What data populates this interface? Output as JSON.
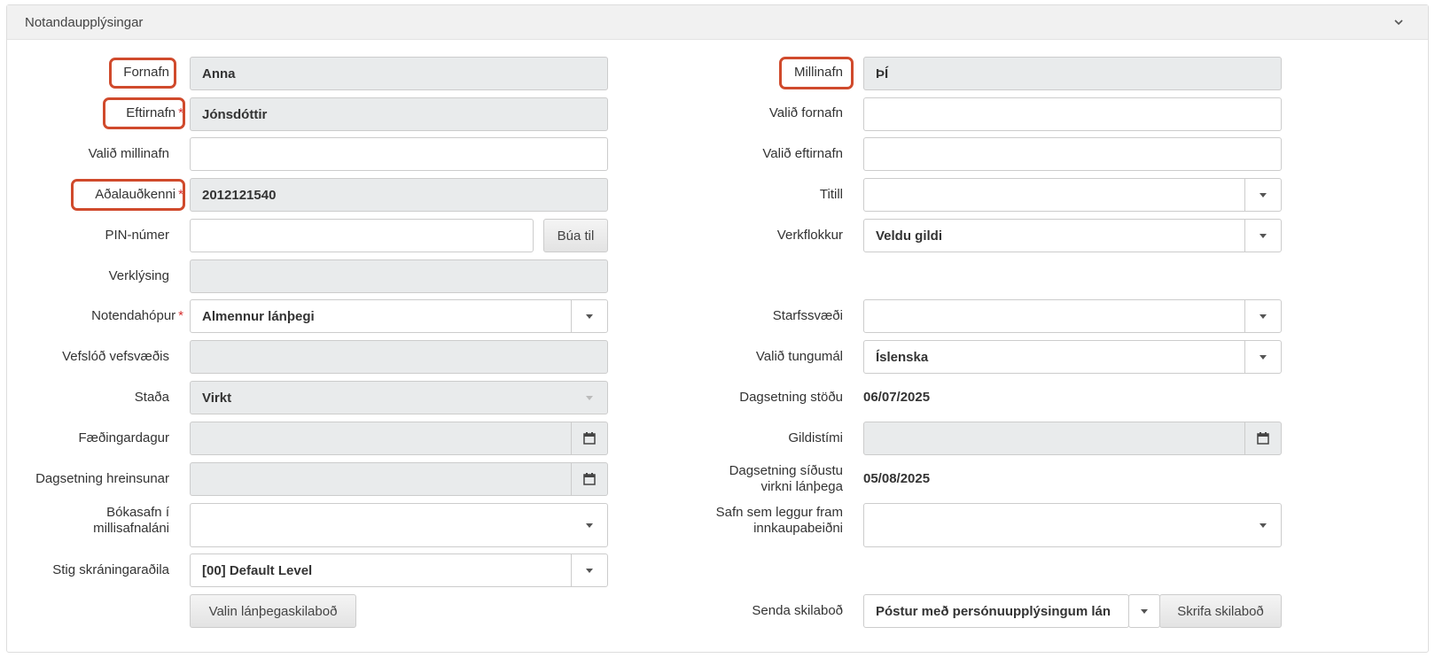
{
  "panel": {
    "title": "Notandaupplýsingar"
  },
  "left": {
    "fornafn": {
      "label": "Fornafn",
      "value": "Anna"
    },
    "eftirnafn": {
      "label": "Eftirnafn",
      "value": "Jónsdóttir",
      "required": "*"
    },
    "valid_millinafn": {
      "label": "Valið millinafn",
      "value": ""
    },
    "adalaudkenni": {
      "label": "Aðalauðkenni",
      "value": "2012121540",
      "required": "*"
    },
    "pin": {
      "label": "PIN-númer",
      "value": "",
      "button": "Búa til"
    },
    "verklysing": {
      "label": "Verklýsing",
      "value": ""
    },
    "notendahopur": {
      "label": "Notendahópur",
      "value": "Almennur lánþegi",
      "required": "*"
    },
    "vefslod": {
      "label": "Vefslóð vefsvæðis",
      "value": ""
    },
    "stada": {
      "label": "Staða",
      "value": "Virkt"
    },
    "faedingardagur": {
      "label": "Fæðingardagur",
      "value": ""
    },
    "hreinsun": {
      "label": "Dagsetning hreinsunar",
      "value": ""
    },
    "bokasafn": {
      "label_line1": "Bókasafn í",
      "label_line2": "millisafnaláni",
      "value": ""
    },
    "stig": {
      "label": "Stig skráningaraðila",
      "value": "[00] Default Level"
    },
    "skilabod_button": "Valin lánþegaskilaboð"
  },
  "right": {
    "millinafn": {
      "label": "Millinafn",
      "value": "ÞÍ"
    },
    "valid_fornafn": {
      "label": "Valið fornafn",
      "value": ""
    },
    "valid_eftirnafn": {
      "label": "Valið eftirnafn",
      "value": ""
    },
    "titill": {
      "label": "Titill",
      "value": ""
    },
    "verkflokkur": {
      "label": "Verkflokkur",
      "value": "Veldu gildi"
    },
    "starfssvaedi": {
      "label": "Starfssvæði",
      "value": ""
    },
    "tungumal": {
      "label": "Valið tungumál",
      "value": "Íslenska"
    },
    "dags_stodu": {
      "label": "Dagsetning stöðu",
      "value": "06/07/2025"
    },
    "gildistimi": {
      "label": "Gildistími",
      "value": ""
    },
    "sidasta_virkni": {
      "label_line1": "Dagsetning síðustu",
      "label_line2": "virkni lánþega",
      "value": "05/08/2025"
    },
    "innkaup": {
      "label_line1": "Safn sem leggur fram",
      "label_line2": "innkaupabeiðni",
      "value": ""
    },
    "senda": {
      "label": "Senda skilaboð",
      "value": "Póstur með persónuupplýsingum lán",
      "button": "Skrifa skilaboð"
    }
  },
  "icons": {
    "chevron": "chevron-down-icon",
    "calendar": "calendar-icon",
    "dropdown": "caret-down-icon"
  },
  "colors": {
    "highlight": "#d04a2c",
    "required": "#d62f2f",
    "readonly_bg": "#e9ebec"
  }
}
